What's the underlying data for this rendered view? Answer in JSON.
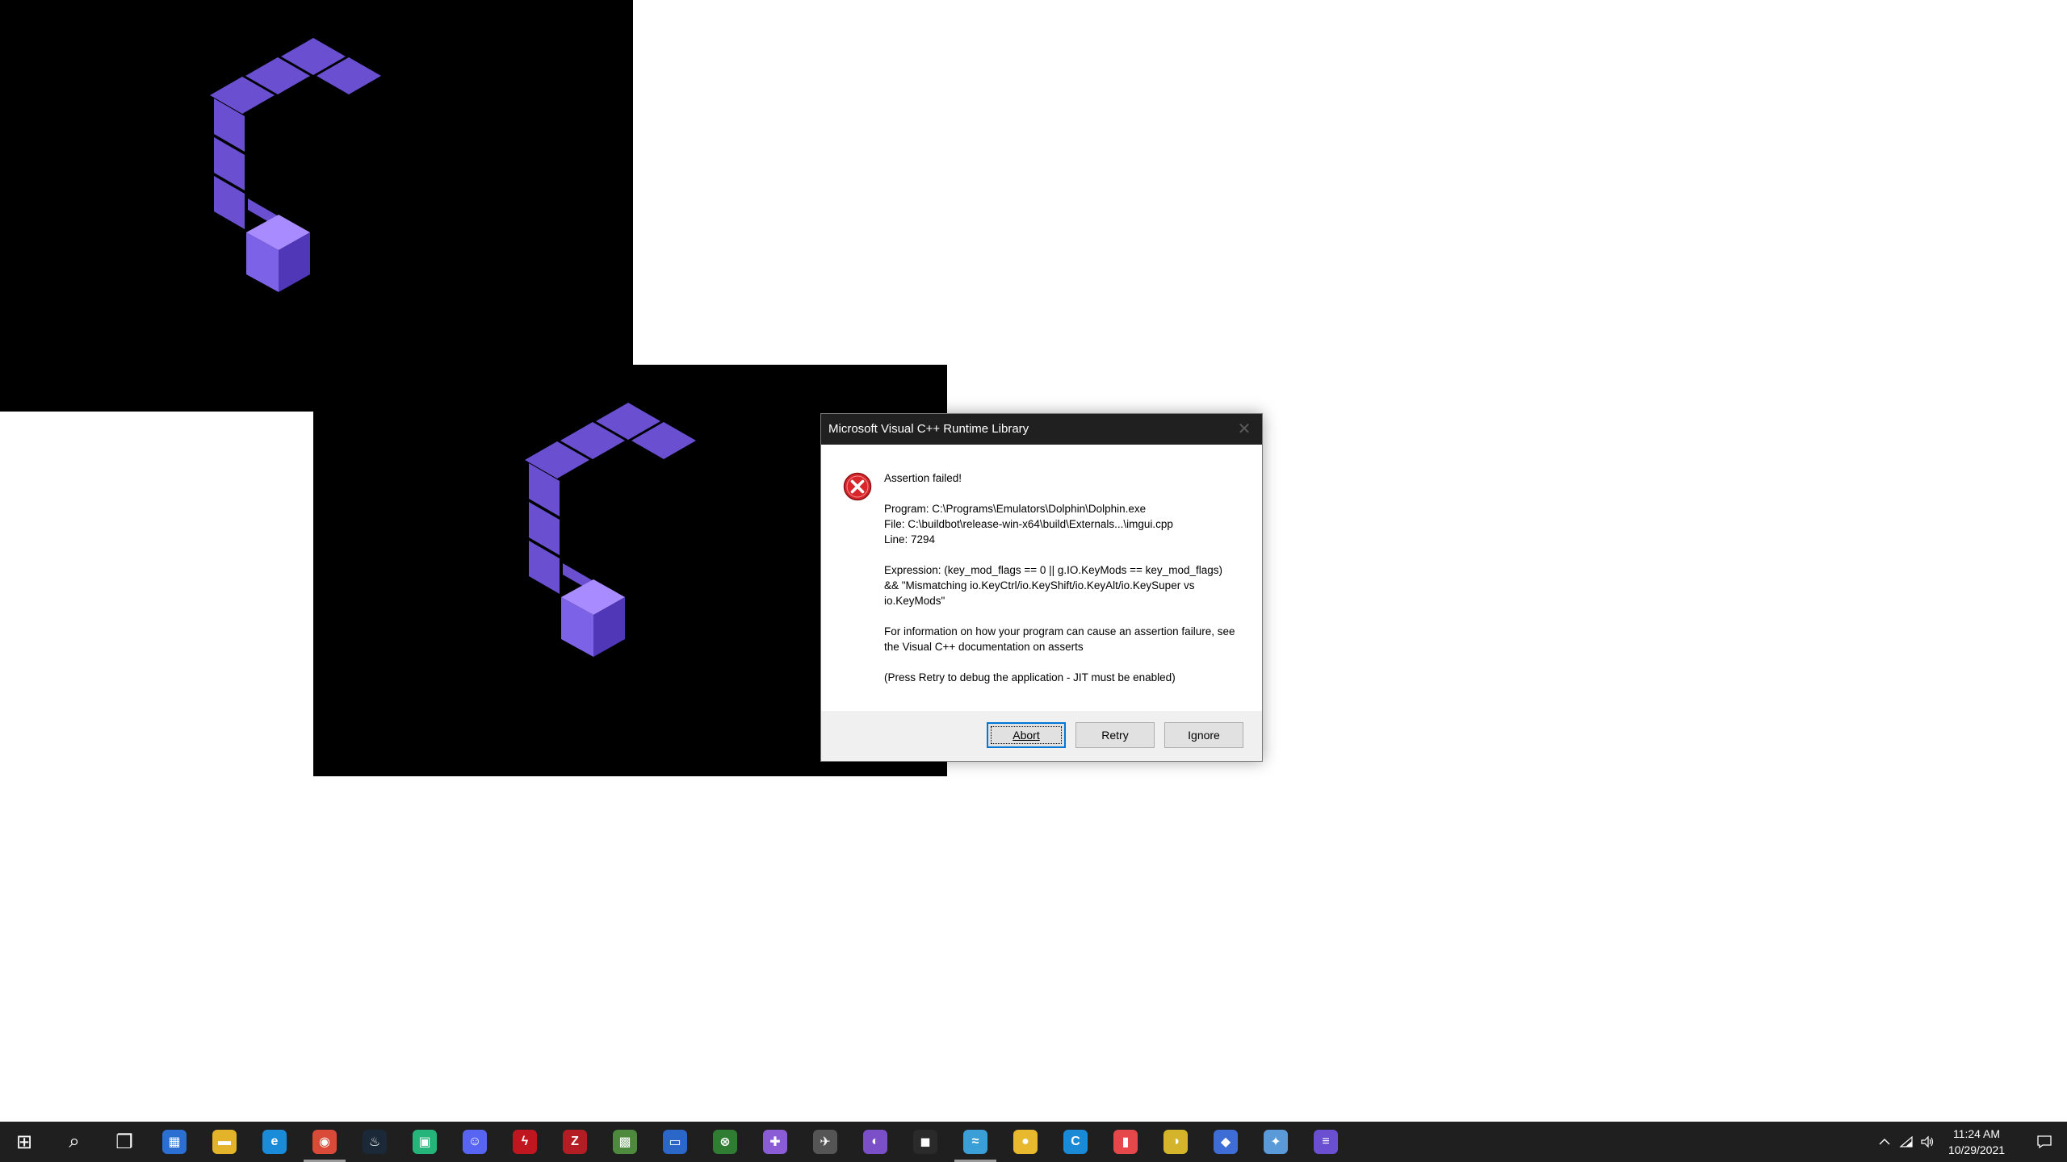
{
  "dialog": {
    "title": "Microsoft Visual C++ Runtime Library",
    "close_glyph": "✕",
    "heading": "Assertion failed!",
    "program_line": "Program: C:\\Programs\\Emulators\\Dolphin\\Dolphin.exe",
    "file_line": "File: C:\\buildbot\\release-win-x64\\build\\Externals...\\imgui.cpp",
    "line_line": "Line: 7294",
    "expression": "Expression: (key_mod_flags == 0 || g.IO.KeyMods == key_mod_flags) && \"Mismatching io.KeyCtrl/io.KeyShift/io.KeyAlt/io.KeySuper vs io.KeyMods\"",
    "info": "For information on how your program can cause an assertion failure, see the Visual C++ documentation on asserts",
    "hint": "(Press Retry to debug the application - JIT must be enabled)",
    "buttons": {
      "abort": "Abort",
      "retry": "Retry",
      "ignore": "Ignore"
    },
    "icon": "error-icon"
  },
  "colors": {
    "logo_purple": "#6a4fd1",
    "logo_light": "#a88cff",
    "taskbar": "#1f1f1f",
    "accent": "#0078d7"
  },
  "taskbar": {
    "apps": [
      {
        "name": "start",
        "glyph": "⊞",
        "color": "#1f1f1f"
      },
      {
        "name": "search",
        "glyph": "⌕",
        "color": "#1f1f1f"
      },
      {
        "name": "task-view",
        "glyph": "❐",
        "color": "#1f1f1f"
      },
      {
        "name": "microsoft-store",
        "glyph": "▦",
        "color": "#2a6fd1"
      },
      {
        "name": "file-explorer",
        "glyph": "▬",
        "color": "#e3b32a"
      },
      {
        "name": "edge",
        "glyph": "e",
        "color": "#1a8bd8"
      },
      {
        "name": "chrome",
        "glyph": "◉",
        "color": "#d94a38"
      },
      {
        "name": "steam",
        "glyph": "♨",
        "color": "#1b2838"
      },
      {
        "name": "app-green",
        "glyph": "▣",
        "color": "#25b57a"
      },
      {
        "name": "discord",
        "glyph": "☺",
        "color": "#5865f2"
      },
      {
        "name": "app-red",
        "glyph": "ϟ",
        "color": "#c0161f"
      },
      {
        "name": "cpu-z",
        "glyph": "Z",
        "color": "#b31d23"
      },
      {
        "name": "app-board",
        "glyph": "▩",
        "color": "#4d8a3e"
      },
      {
        "name": "remote-desktop",
        "glyph": "▭",
        "color": "#2b66c9"
      },
      {
        "name": "xbox",
        "glyph": "⊗",
        "color": "#2e7d32"
      },
      {
        "name": "gamepad",
        "glyph": "✚",
        "color": "#8a5cd6"
      },
      {
        "name": "app-bird",
        "glyph": "✈",
        "color": "#555555"
      },
      {
        "name": "app-purple",
        "glyph": "◐",
        "color": "#7b4fc8"
      },
      {
        "name": "app-dark",
        "glyph": "◼",
        "color": "#2a2a2a"
      },
      {
        "name": "dolphin",
        "glyph": "≈",
        "color": "#3a9fd6"
      },
      {
        "name": "app-coin",
        "glyph": "●",
        "color": "#e8b92e"
      },
      {
        "name": "app-c",
        "glyph": "C",
        "color": "#1b8ad6"
      },
      {
        "name": "yuzu",
        "glyph": "▮",
        "color": "#e4484b"
      },
      {
        "name": "app-yellow",
        "glyph": "◑",
        "color": "#d4b42a"
      },
      {
        "name": "app-diamond",
        "glyph": "◆",
        "color": "#3f6dd6"
      },
      {
        "name": "app-controller",
        "glyph": "✦",
        "color": "#5a9ad9"
      },
      {
        "name": "app-list",
        "glyph": "≡",
        "color": "#6b4fd1"
      }
    ]
  },
  "tray": {
    "time": "11:24 AM",
    "date": "10/29/2021"
  }
}
